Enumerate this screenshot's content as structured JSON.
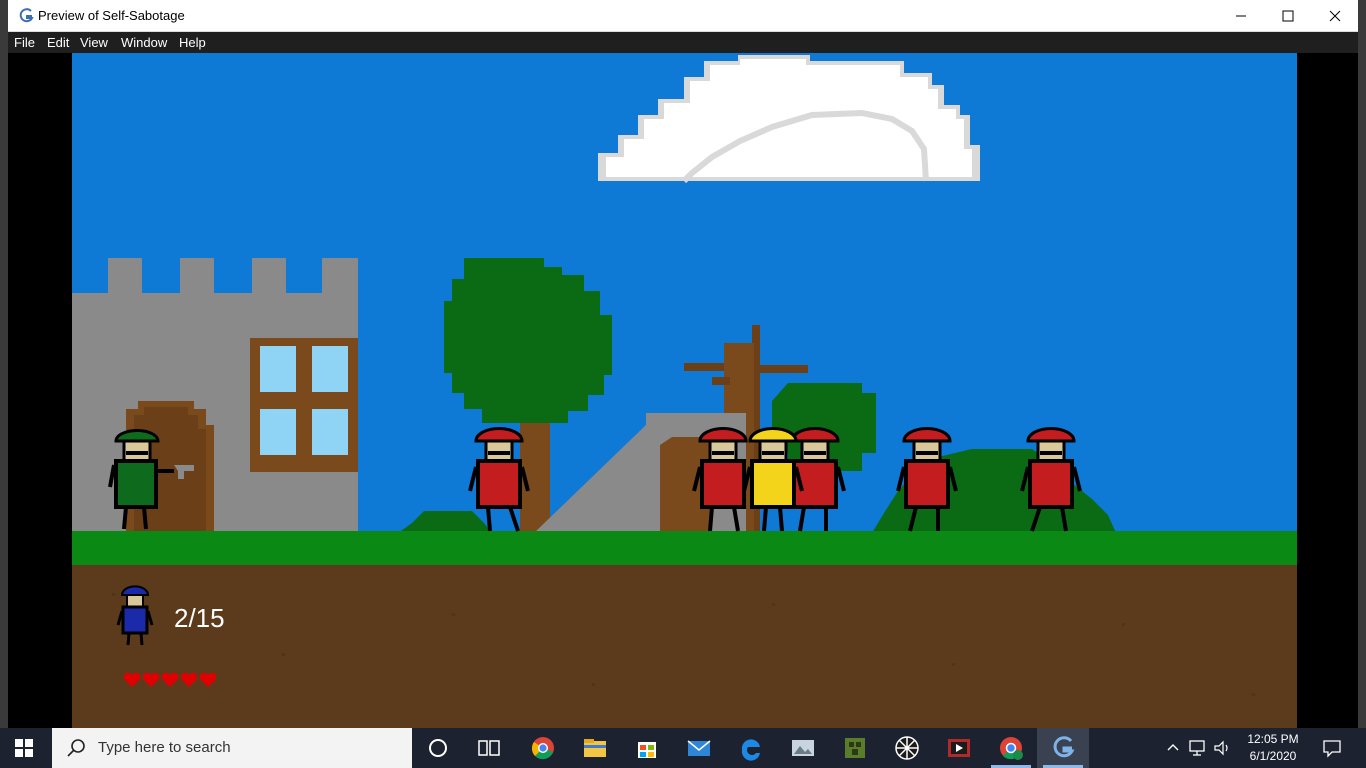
{
  "window": {
    "title": "Preview of Self-Sabotage",
    "controls": [
      "minimize",
      "maximize",
      "close"
    ]
  },
  "menu": {
    "items": [
      "File",
      "Edit",
      "View",
      "Window",
      "Help"
    ]
  },
  "game": {
    "hud": {
      "player_icon": "blue-soldier-icon",
      "count": "2/15",
      "hearts": 5
    },
    "colors": {
      "sky": "#0f79d6",
      "grass": "#0a8a14",
      "dirt": "#5c3b1d",
      "enemy": "#c41d20",
      "player": "#0e6b1e",
      "ally": "#f4d41a"
    }
  },
  "taskbar": {
    "search_placeholder": "Type here to search",
    "apps": [
      "cortana-icon",
      "task-view-icon",
      "chrome-icon",
      "file-explorer-icon",
      "store-icon",
      "mail-icon",
      "edge-icon",
      "photos-icon",
      "minecraft-icon",
      "game-app-icon",
      "video-icon",
      "chrome-profile-icon",
      "gamemaker-icon"
    ],
    "time": "12:05 PM",
    "date": "6/1/2020"
  }
}
